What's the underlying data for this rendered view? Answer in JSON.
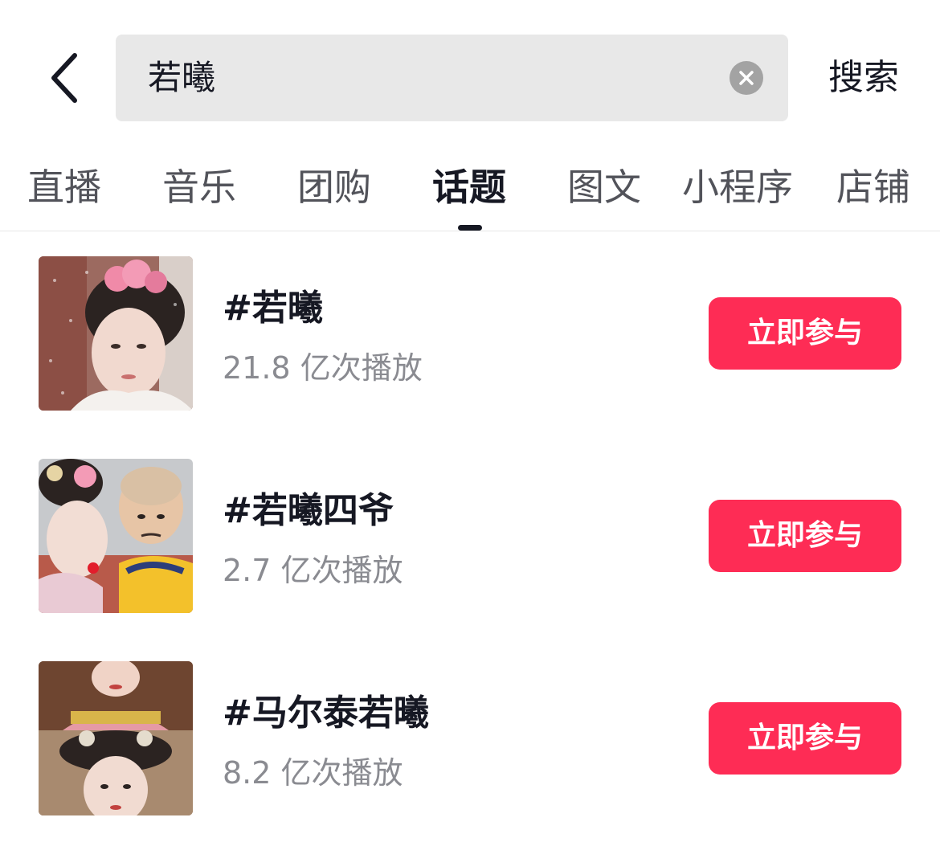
{
  "search": {
    "query": "若曦",
    "submit_label": "搜索"
  },
  "tabs": [
    {
      "label": "直播",
      "active": false
    },
    {
      "label": "音乐",
      "active": false
    },
    {
      "label": "团购",
      "active": false
    },
    {
      "label": "话题",
      "active": true
    },
    {
      "label": "图文",
      "active": false
    },
    {
      "label": "小程序",
      "active": false
    },
    {
      "label": "店铺",
      "active": false
    }
  ],
  "topics": [
    {
      "title": "#若曦",
      "plays": "21.8 亿次播放",
      "action_label": "立即参与"
    },
    {
      "title": "#若曦四爷",
      "plays": "2.7 亿次播放",
      "action_label": "立即参与"
    },
    {
      "title": "#马尔泰若曦",
      "plays": "8.2 亿次播放",
      "action_label": "立即参与"
    }
  ],
  "colors": {
    "accent": "#fe2c55",
    "text_primary": "#161823",
    "text_secondary": "#8a8b91",
    "search_bg": "#e8e8e8"
  },
  "icons": {
    "back": "chevron-left-icon",
    "clear": "clear-circle-icon"
  }
}
